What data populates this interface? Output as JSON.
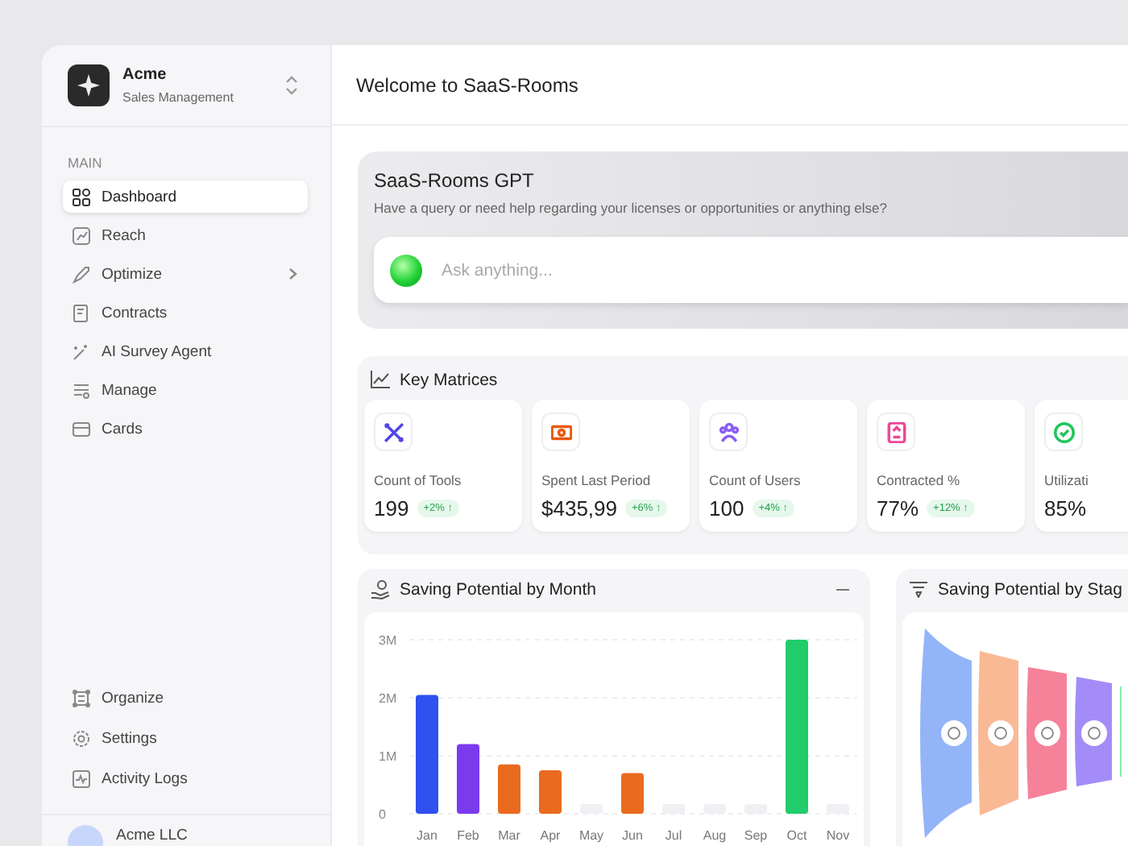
{
  "sidebar": {
    "brand": {
      "name": "Acme",
      "subtitle": "Sales Management"
    },
    "section_label": "MAIN",
    "items": [
      {
        "label": "Dashboard",
        "selected": true,
        "expandable": false
      },
      {
        "label": "Reach",
        "selected": false,
        "expandable": false
      },
      {
        "label": "Optimize",
        "selected": false,
        "expandable": true
      },
      {
        "label": "Contracts",
        "selected": false,
        "expandable": false
      },
      {
        "label": "AI Survey Agent",
        "selected": false,
        "expandable": false
      },
      {
        "label": "Manage",
        "selected": false,
        "expandable": false
      },
      {
        "label": "Cards",
        "selected": false,
        "expandable": false
      }
    ],
    "bottom_items": [
      {
        "label": "Organize"
      },
      {
        "label": "Settings"
      },
      {
        "label": "Activity Logs"
      }
    ],
    "user": {
      "name": "Acme LLC"
    }
  },
  "header": {
    "title": "Welcome to SaaS-Rooms"
  },
  "assistant": {
    "title": "SaaS-Rooms GPT",
    "subtitle": "Have a query or need help regarding your licenses or opportunities or anything else?",
    "placeholder": "Ask anything..."
  },
  "key_metrics": {
    "title": "Key Matrices",
    "cards": [
      {
        "label": "Count of Tools",
        "value": "199",
        "change": "+2% ↑",
        "color": "#4f46e5"
      },
      {
        "label": "Spent Last Period",
        "value": "$435,99",
        "change": "+6% ↑",
        "color": "#ea580c"
      },
      {
        "label": "Count of Users",
        "value": "100",
        "change": "+4% ↑",
        "color": "#8b5cf6"
      },
      {
        "label": "Contracted %",
        "value": "77%",
        "change": "+12% ↑",
        "color": "#ec4899"
      },
      {
        "label": "Utilizati",
        "value": "85%",
        "color": "#22c55e"
      }
    ]
  },
  "monthly_panel": {
    "title": "Saving Potential by Month",
    "chart_data": {
      "type": "bar",
      "categories": [
        "Jan",
        "Feb",
        "Mar",
        "Apr",
        "May",
        "Jun",
        "Jul",
        "Aug",
        "Sep",
        "Oct",
        "Nov"
      ],
      "series": [
        {
          "color": "#3050f0",
          "values": [
            2.05,
            null,
            null,
            null,
            0,
            null,
            0,
            0,
            0,
            null,
            0
          ]
        },
        {
          "color": "#7c3aed",
          "values": [
            null,
            1.2,
            null,
            null,
            null,
            null,
            null,
            null,
            null,
            null,
            null
          ]
        },
        {
          "color": "#ea6a20",
          "values": [
            null,
            null,
            0.85,
            0.75,
            null,
            0.7,
            null,
            null,
            null,
            null,
            null
          ]
        },
        {
          "color": "#22cc6a",
          "values": [
            null,
            null,
            null,
            null,
            null,
            null,
            null,
            null,
            null,
            3.0,
            null
          ]
        }
      ],
      "ylim": [
        0,
        3
      ],
      "yticks": [
        {
          "value": 0,
          "label": "0"
        },
        {
          "value": 1,
          "label": "1M"
        },
        {
          "value": 2,
          "label": "2M"
        },
        {
          "value": 3,
          "label": "3M"
        }
      ]
    }
  },
  "stage_panel": {
    "title": "Saving Potential by Stag"
  }
}
